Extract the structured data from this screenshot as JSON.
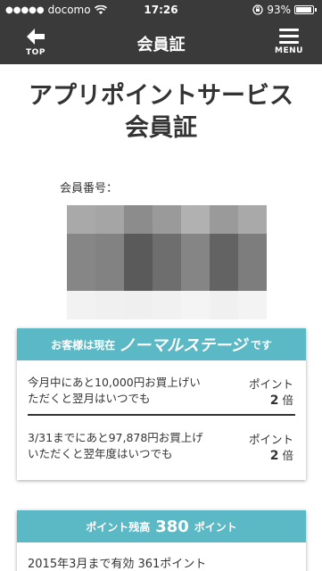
{
  "status_bar": {
    "carrier": "docomo",
    "time": "17:26",
    "battery": "93%"
  },
  "nav": {
    "top_label": "TOP",
    "title": "会員証",
    "menu_label": "MENU"
  },
  "main": {
    "title_line1": "アプリポイントサービス",
    "title_line2": "会員証",
    "member_label": "会員番号："
  },
  "barcode_colors": [
    [
      "#a9a9a9",
      "#a5a5a5",
      "#8c8c8c",
      "#9a9a9a",
      "#b1b1b1",
      "#9a9a9a",
      "#a9a9a9"
    ],
    [
      "#868686",
      "#828282",
      "#5a5a5a",
      "#6e6e6e",
      "#858585",
      "#636363",
      "#7d7d7d"
    ],
    [
      "#f2f2f2",
      "#f0f0f0",
      "#efefef",
      "#f1f1f1",
      "#f4f4f4",
      "#f0f0f0",
      "#f3f3f3"
    ]
  ],
  "stage_card": {
    "header_prefix": "お客様は現在",
    "stage_name": "ノーマルステージ",
    "header_suffix": "です",
    "rows": [
      {
        "line1": "今月中にあと10,000円お買上げい",
        "line2": "ただくと翌月はいつでも",
        "point_label": "ポイント",
        "multiplier": "2",
        "unit": "倍"
      },
      {
        "line1": "3/31までにあと97,878円お買上げ",
        "line2": "いただくと翌年度はいつでも",
        "point_label": "ポイント",
        "multiplier": "2",
        "unit": "倍"
      }
    ]
  },
  "points_card": {
    "header_prefix": "ポイント残高",
    "balance": "380",
    "header_suffix": "ポイント",
    "row_text": "2015年3月まで有効  361ポイント"
  },
  "colors": {
    "bar_bg": "#3a3a3a",
    "accent": "#5bb8c5"
  }
}
